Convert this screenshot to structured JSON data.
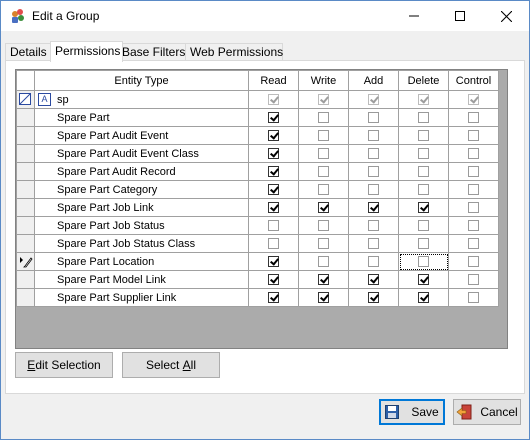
{
  "window": {
    "title": "Edit a Group"
  },
  "tabs": [
    {
      "label": "Details",
      "active": false
    },
    {
      "label": "Permissions",
      "active": true
    },
    {
      "label": "Base Filters",
      "active": false
    },
    {
      "label": "Web Permissions",
      "active": false
    }
  ],
  "grid": {
    "columns": [
      "Entity Type",
      "Read",
      "Write",
      "Add",
      "Delete",
      "Control"
    ],
    "filter_row": {
      "text": "sp",
      "checks": [
        true,
        true,
        true,
        true,
        true
      ]
    },
    "rows": [
      {
        "name": "Spare Part",
        "checks": [
          true,
          false,
          false,
          false,
          false
        ]
      },
      {
        "name": "Spare Part Audit Event",
        "checks": [
          true,
          false,
          false,
          false,
          false
        ]
      },
      {
        "name": "Spare Part Audit Event Class",
        "checks": [
          true,
          false,
          false,
          false,
          false
        ]
      },
      {
        "name": "Spare Part Audit Record",
        "checks": [
          true,
          false,
          false,
          false,
          false
        ]
      },
      {
        "name": "Spare Part Category",
        "checks": [
          true,
          false,
          false,
          false,
          false
        ]
      },
      {
        "name": "Spare Part Job Link",
        "checks": [
          true,
          true,
          true,
          true,
          false
        ]
      },
      {
        "name": "Spare Part Job Status",
        "checks": [
          false,
          false,
          false,
          false,
          false
        ]
      },
      {
        "name": "Spare Part Job Status Class",
        "checks": [
          false,
          false,
          false,
          false,
          false
        ]
      },
      {
        "name": "Spare Part Location",
        "checks": [
          true,
          false,
          false,
          false,
          false
        ],
        "editing": true
      },
      {
        "name": "Spare Part Model Link",
        "checks": [
          true,
          true,
          true,
          true,
          false
        ]
      },
      {
        "name": "Spare Part Supplier Link",
        "checks": [
          true,
          true,
          true,
          true,
          false
        ]
      }
    ]
  },
  "buttons": {
    "edit_selection_prefix": "E",
    "edit_selection_rest": "dit Selection",
    "select_all_prefix": "Select ",
    "select_all_underlined": "A",
    "select_all_rest": "ll",
    "save": "Save",
    "cancel": "Cancel"
  },
  "colors": {
    "accent": "#0078d7",
    "grid_bg": "#ababab"
  }
}
